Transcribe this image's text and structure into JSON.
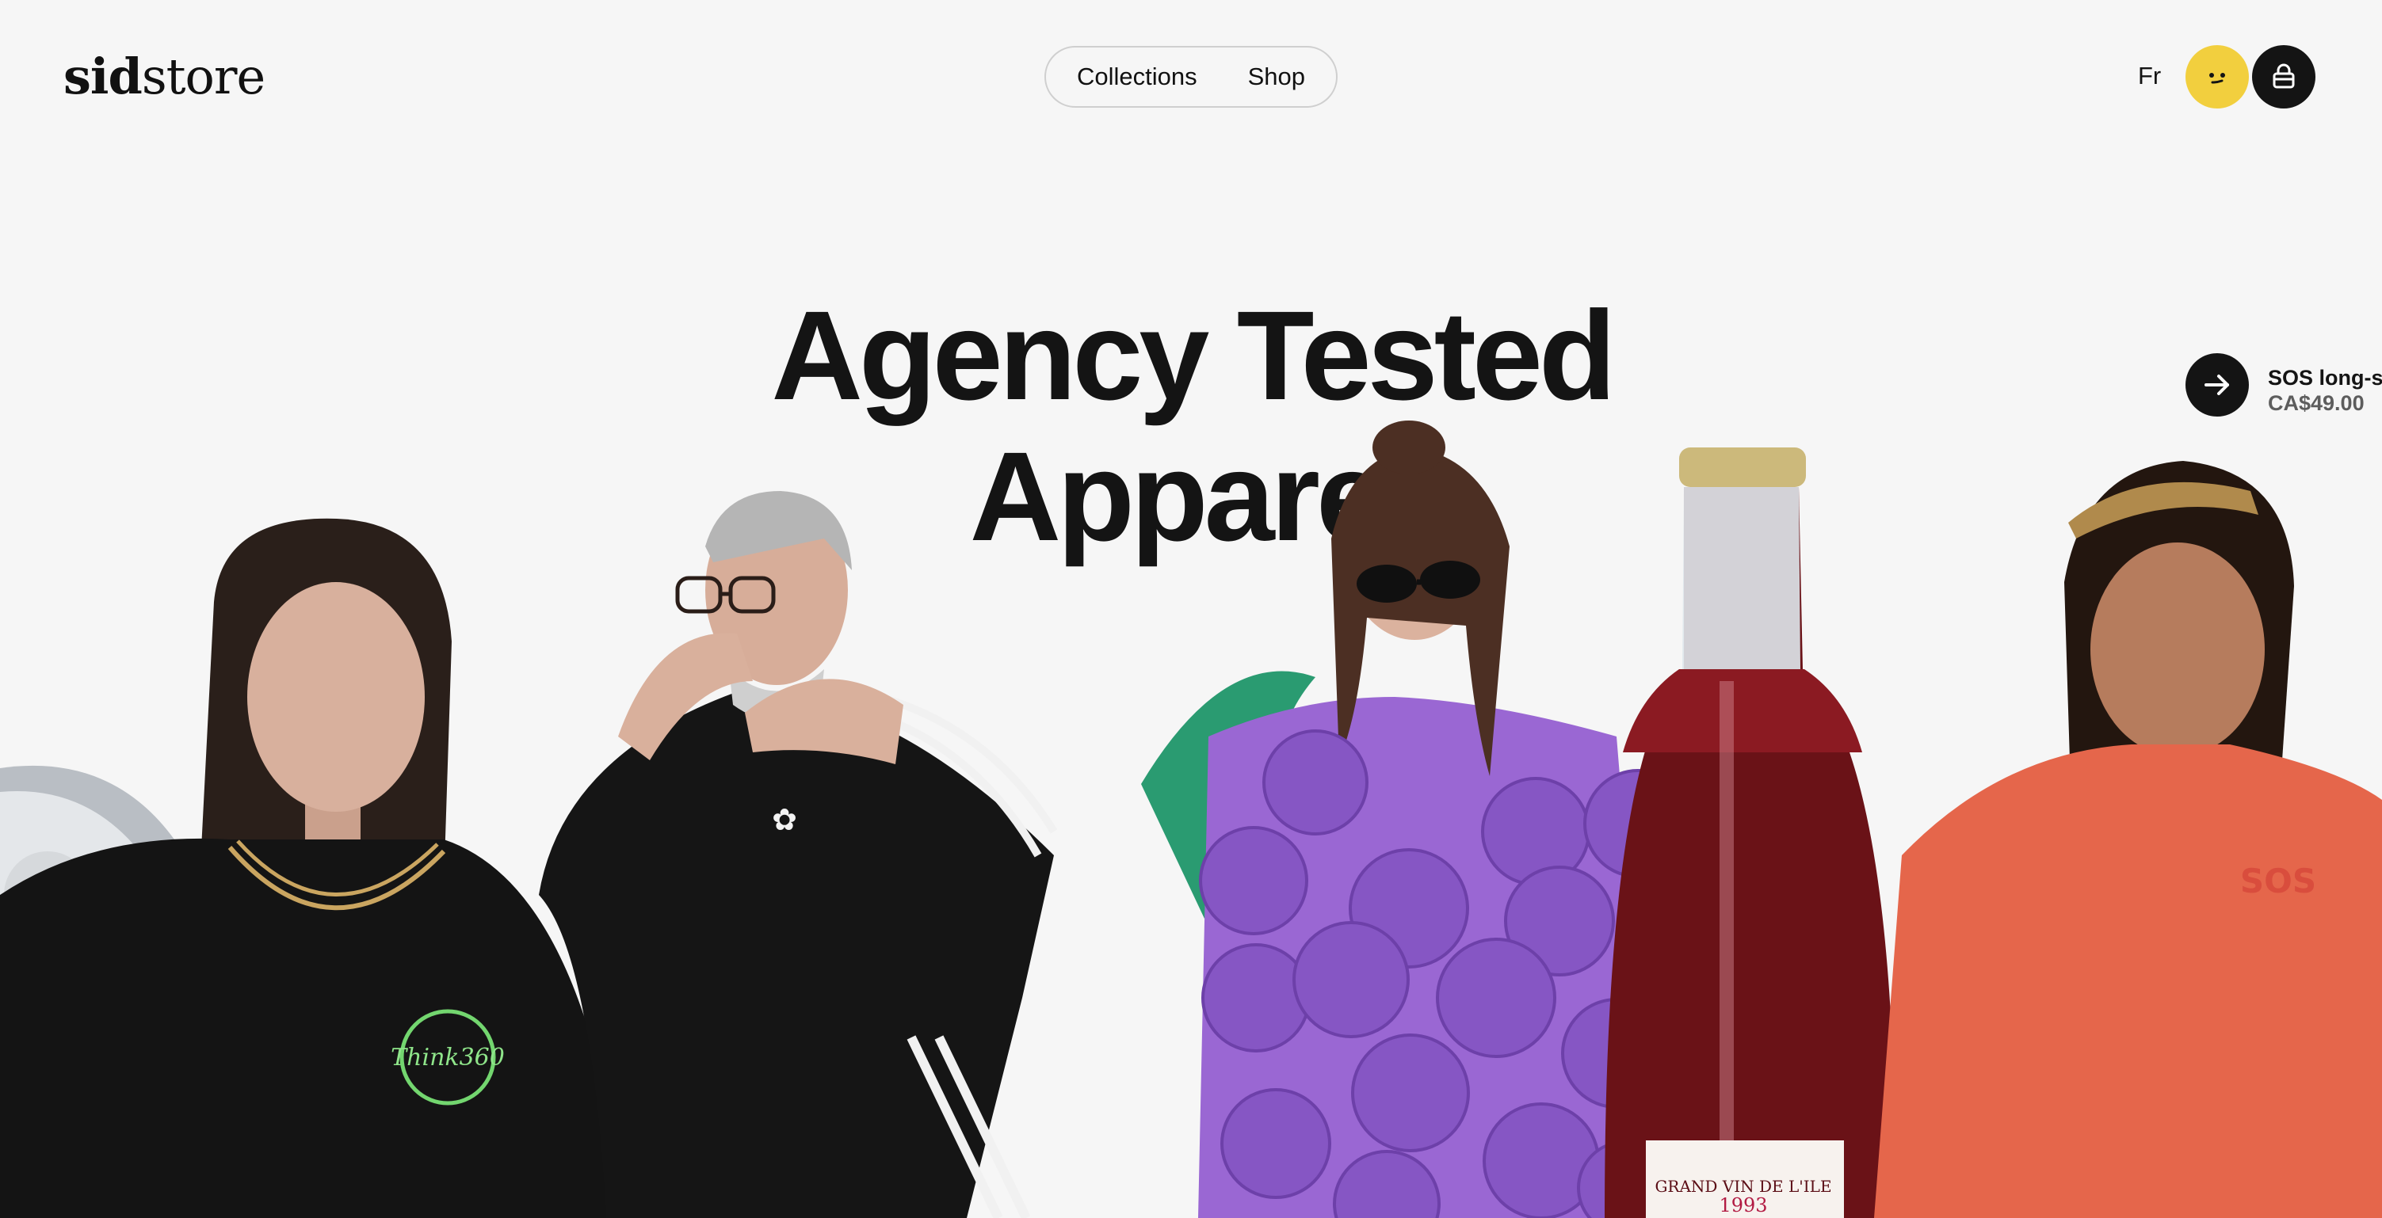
{
  "header": {
    "logo_first": "sid",
    "logo_second": "store",
    "nav": [
      "Collections",
      "Shop"
    ],
    "language": "Fr"
  },
  "hero": {
    "title_line1": "Agency Tested",
    "title_line2": "Apparel"
  },
  "featured_product": {
    "name": "SOS long-sle",
    "price": "CA$49.00"
  },
  "product_prints": {
    "shirt_logo": "Think360",
    "orange_tee_text": "SOS",
    "bottle_label": "GRAND VIN DE L'ILE",
    "bottle_year": "1993"
  },
  "colors": {
    "background": "#f6f6f6",
    "profile_yellow": "#f2cf3e",
    "dark": "#141414",
    "grape_purple": "#8f5dc8",
    "orange_tee": "#e5664b"
  }
}
